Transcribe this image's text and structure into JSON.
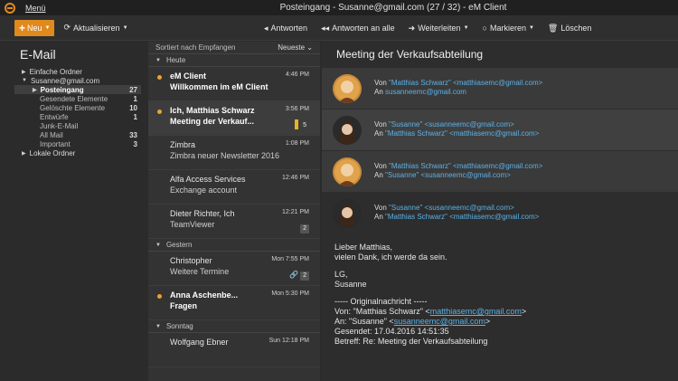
{
  "window": {
    "menu_label": "Menü",
    "title": "Posteingang - Susanne@gmail.com (27 / 32) - eM Client"
  },
  "toolbar": {
    "new_label": "Neu",
    "refresh_label": "Aktualisieren",
    "reply_label": "Antworten",
    "reply_all_label": "Antworten an alle",
    "forward_label": "Weiterleiten",
    "mark_label": "Markieren",
    "delete_label": "Löschen"
  },
  "sidebar": {
    "title": "E-Mail",
    "items": [
      {
        "label": "Einfache Ordner",
        "count": ""
      },
      {
        "label": "Susanne@gmail.com",
        "count": ""
      },
      {
        "label": "Posteingang",
        "count": "27"
      },
      {
        "label": "Gesendete Elemente",
        "count": "1"
      },
      {
        "label": "Gelöschte Elemente",
        "count": "10"
      },
      {
        "label": "Entwürfe",
        "count": "1"
      },
      {
        "label": "Junk-E-Mail",
        "count": ""
      },
      {
        "label": "All Mail",
        "count": "33"
      },
      {
        "label": "Important",
        "count": "3"
      },
      {
        "label": "Lokale Ordner",
        "count": ""
      }
    ]
  },
  "list": {
    "sort_label": "Sortiert nach Empfangen",
    "order_label": "Neueste",
    "groups": [
      "Heute",
      "Gestern",
      "Sonntag"
    ],
    "messages": [
      {
        "from": "eM Client",
        "time": "4:46 PM",
        "subject": "Willkommen im eM Client",
        "badge": ""
      },
      {
        "from": "Ich, Matthias Schwarz",
        "time": "3:56 PM",
        "subject": "Meeting der Verkauf...",
        "badge": "5"
      },
      {
        "from": "Zimbra",
        "time": "1:08 PM",
        "subject": "Zimbra neuer Newsletter 2016",
        "badge": ""
      },
      {
        "from": "Alfa Access Services",
        "time": "12:46 PM",
        "subject": "Exchange account",
        "badge": ""
      },
      {
        "from": "Dieter Richter, Ich",
        "time": "12:21 PM",
        "subject": "TeamViewer",
        "badge": "2"
      },
      {
        "from": "Christopher",
        "time": "Mon 7:55 PM",
        "subject": "Weitere Termine",
        "badge": "2"
      },
      {
        "from": "Anna Aschenbe...",
        "time": "Mon 5:30 PM",
        "subject": "Fragen",
        "badge": ""
      },
      {
        "from": "Wolfgang Ebner",
        "time": "Sun 12:18 PM",
        "subject": "",
        "badge": ""
      }
    ]
  },
  "reader": {
    "subject": "Meeting der Verkaufsabteilung",
    "thread": [
      {
        "from_label": "Von",
        "from": "\"Matthias Schwarz\" <matthiasemc@gmail.com>",
        "to_label": "An",
        "to": "susanneemc@gmail.com"
      },
      {
        "from_label": "Von",
        "from": "\"Susanne\" <susanneemc@gmail.com>",
        "to_label": "An",
        "to": "\"Matthias Schwarz\" <matthiasemc@gmail.com>"
      },
      {
        "from_label": "Von",
        "from": "\"Matthias Schwarz\" <matthiasemc@gmail.com>",
        "to_label": "An",
        "to": "\"Susanne\" <susanneemc@gmail.com>"
      },
      {
        "from_label": "Von",
        "from": "\"Susanne\" <susanneemc@gmail.com>",
        "to_label": "An",
        "to": "\"Matthias Schwarz\" <matthiasemc@gmail.com>"
      }
    ],
    "body": {
      "greeting": "Lieber Matthias,",
      "line1": "vielen Dank, ich werde da sein.",
      "sign1": "LG,",
      "sign2": "Susanne",
      "orig_header": "----- Originalnachricht -----",
      "orig_from_prefix": "Von: \"Matthias Schwarz\" <",
      "orig_from_link": "matthiasemc@gmail.com",
      "orig_from_suffix": ">",
      "orig_to_prefix": "An: \"Susanne\" <",
      "orig_to_link": "susanneemc@gmail.com",
      "orig_to_suffix": ">",
      "orig_sent": "Gesendet: 17.04.2016 14:51:35",
      "orig_subject": "Betreff: Re: Meeting der Verkaufsabteilung"
    }
  },
  "colors": {
    "accent": "#e08a1e",
    "link": "#5bb2e8",
    "unread_dot": "#f0a030",
    "flag": "#e6b422"
  }
}
